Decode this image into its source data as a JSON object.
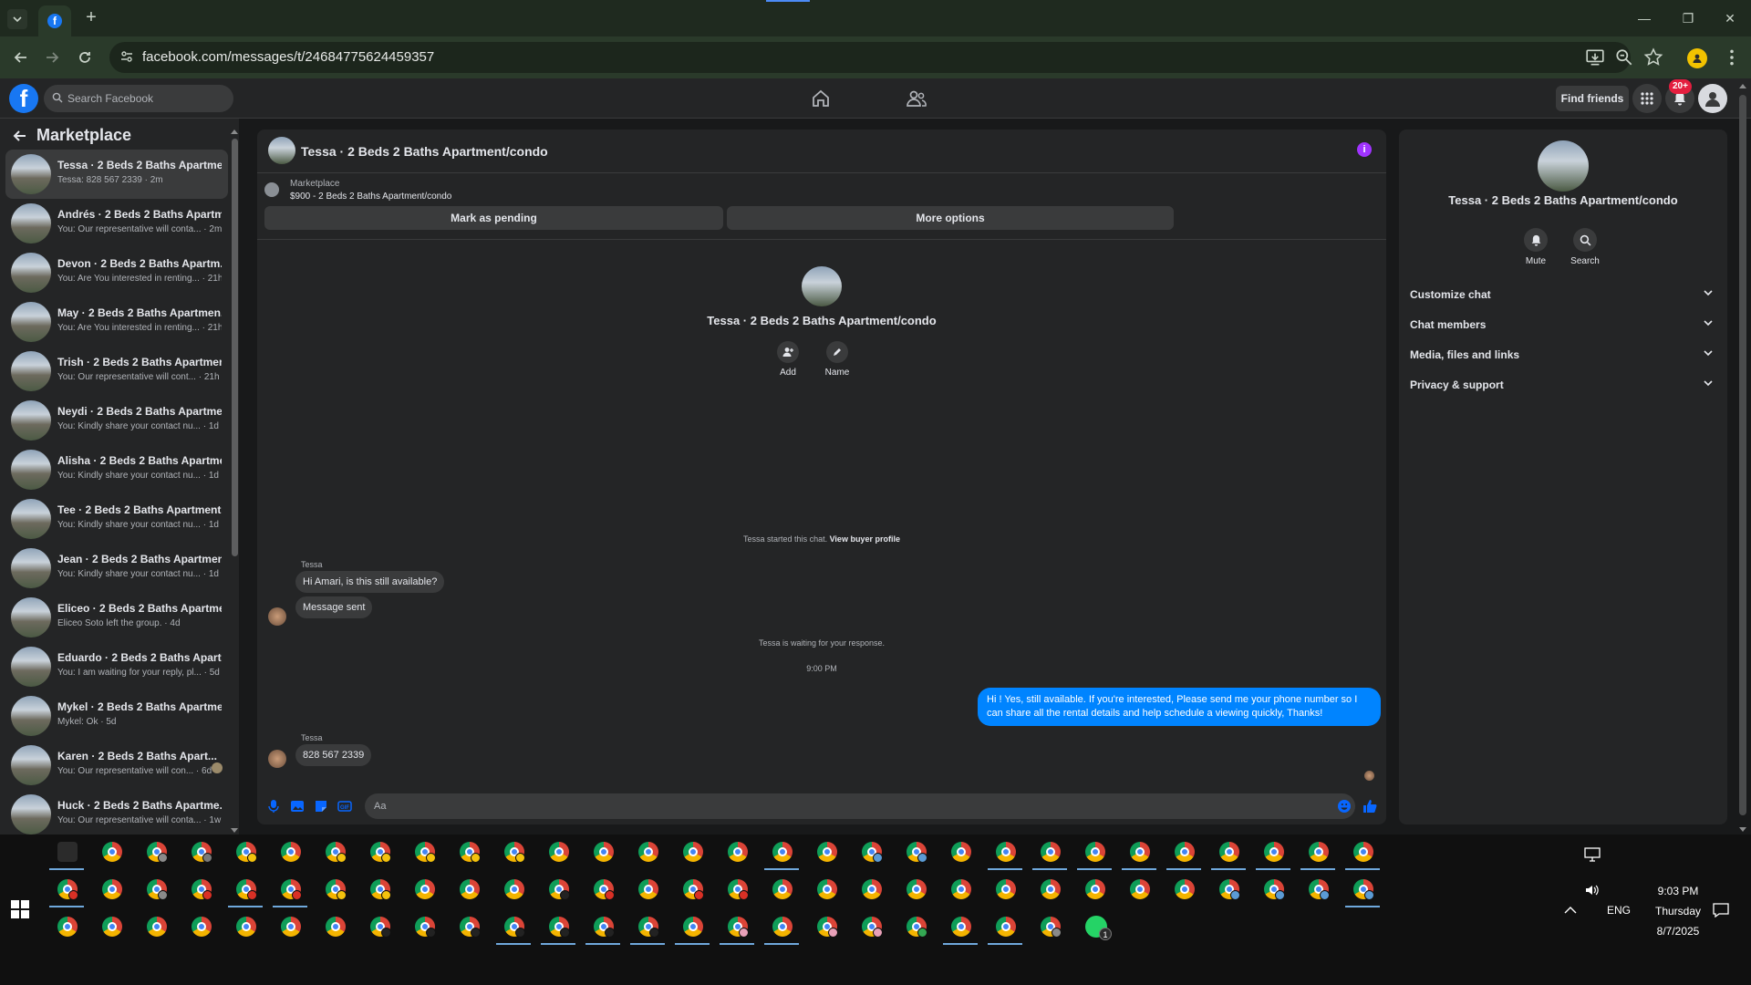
{
  "browser": {
    "url": "facebook.com/messages/t/24684775624459357",
    "new_tab_symbol": "+"
  },
  "fb": {
    "search_placeholder": "Search Facebook",
    "find_friends": "Find friends",
    "notif_count": "20+",
    "brand_color": "#1877f2"
  },
  "sidebar": {
    "title": "Marketplace",
    "conversations": [
      {
        "name": "Tessa · 2 Beds 2 Baths Apartme...",
        "preview": "Tessa: 828 567 2339 · 2m",
        "active": true
      },
      {
        "name": "Andrés · 2 Beds 2 Baths Apartm...",
        "preview": "You: Our representative will conta... · 2m"
      },
      {
        "name": "Devon · 2 Beds 2 Baths Apartm...",
        "preview": "You: Are You interested in renting... · 21h"
      },
      {
        "name": "May · 2 Beds 2 Baths Apartmen...",
        "preview": "You: Are You interested in renting... · 21h"
      },
      {
        "name": "Trish · 2 Beds 2 Baths Apartmen...",
        "preview": "You: Our representative will cont... · 21h"
      },
      {
        "name": "Neydi · 2 Beds 2 Baths Apartme...",
        "preview": "You: Kindly share your contact nu... · 1d"
      },
      {
        "name": "Alisha · 2 Beds 2 Baths Apartme...",
        "preview": "You: Kindly share your contact nu... · 1d"
      },
      {
        "name": "Tee · 2 Beds 2 Baths Apartment...",
        "preview": "You: Kindly share your contact nu... · 1d"
      },
      {
        "name": "Jean · 2 Beds 2 Baths Apartmen...",
        "preview": "You: Kindly share your contact nu... · 1d"
      },
      {
        "name": "Eliceo · 2 Beds 2 Baths Apartme...",
        "preview": "Eliceo Soto left the group. · 4d"
      },
      {
        "name": "Eduardo · 2 Beds 2 Baths Apart...",
        "preview": "You: I am waiting for your reply, pl... · 5d"
      },
      {
        "name": "Mykel · 2 Beds 2 Baths Apartme...",
        "preview": "Mykel: Ok · 5d"
      },
      {
        "name": "Karen · 2 Beds 2 Baths Apart...",
        "preview": "You: Our representative will con... · 6d",
        "seen": true
      },
      {
        "name": "Huck · 2 Beds 2 Baths Apartme...",
        "preview": "You: Our representative will conta... · 1w"
      }
    ]
  },
  "chat": {
    "title": "Tessa · 2 Beds 2 Baths Apartment/condo",
    "marketplace_label": "Marketplace",
    "listing": "$900 - 2 Beds 2 Baths Apartment/condo",
    "mark_pending": "Mark as pending",
    "more_options": "More options",
    "intro_name": "Tessa · 2 Beds 2 Baths Apartment/condo",
    "add_label": "Add",
    "name_label": "Name",
    "started_text": "Tessa started this chat.",
    "view_buyer": "View buyer profile",
    "sender1": "Tessa",
    "msg1": "Hi Amari, is this still available?",
    "msg2": "Message sent",
    "waiting": "Tessa is waiting for your response.",
    "time": "9:00 PM",
    "out_msg": "Hi ! Yes, still available. If you're interested, Please send me your phone number so I can share all the rental details and help schedule a viewing quickly, Thanks!",
    "sender2": "Tessa",
    "msg3": "828 567 2339",
    "composer_placeholder": "Aa"
  },
  "details": {
    "name": "Tessa · 2 Beds 2 Baths Apartment/condo",
    "mute": "Mute",
    "search": "Search",
    "sections": [
      "Customize chat",
      "Chat members",
      "Media, files and links",
      "Privacy & support"
    ]
  },
  "taskbar": {
    "rows": [
      [
        "pinned",
        "",
        "gray",
        "A",
        "yellow",
        "",
        "yellow",
        "yellow",
        "yellow",
        "yellow",
        "yellow",
        "",
        "",
        "",
        "",
        "",
        "",
        "",
        "blue",
        "blue",
        "",
        "",
        "",
        "",
        "",
        "",
        "",
        "",
        "",
        ""
      ],
      [
        "red",
        "",
        "gray",
        "red",
        "red",
        "red",
        "yellow",
        "yellow",
        "",
        "",
        "",
        "dark",
        "red",
        "",
        "red",
        "red",
        "",
        "",
        "",
        "",
        "",
        "",
        "",
        "",
        "",
        "",
        "blue",
        "blue",
        "blue",
        "blue"
      ],
      [
        "",
        "",
        "",
        "",
        "",
        "",
        "",
        "dark",
        "dark",
        "dark",
        "dark",
        "dark",
        "dark",
        "dark",
        "",
        "pink",
        "",
        "pink",
        "pink",
        "green",
        "",
        "",
        "gray",
        "wa"
      ]
    ],
    "underlined": [
      [
        0,
        16,
        21,
        22,
        23,
        24,
        25,
        26,
        27,
        28,
        29,
        30,
        31
      ],
      [
        0,
        4,
        5,
        29,
        30,
        31,
        32
      ],
      [
        10,
        11,
        12,
        13,
        14,
        15,
        16,
        20,
        21
      ]
    ],
    "lang": "ENG",
    "time": "9:03 PM",
    "day": "Thursday",
    "date": "8/7/2025",
    "whatsapp_badge": "1"
  }
}
